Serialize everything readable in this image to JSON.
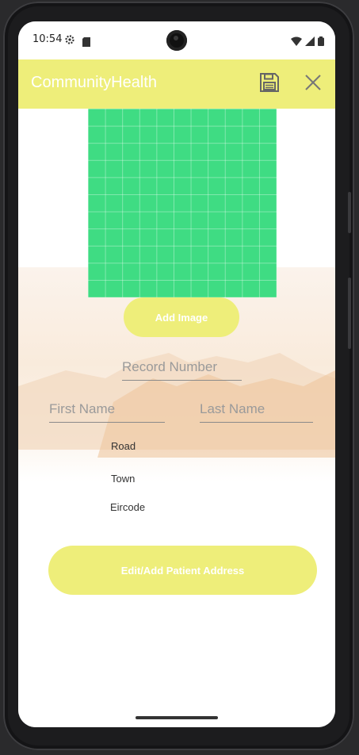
{
  "status_bar": {
    "time": "10:54",
    "icons": [
      "gear-icon",
      "sd-card-icon",
      "wifi-icon",
      "signal-icon",
      "battery-icon"
    ]
  },
  "appbar": {
    "title": "CommunityHealth",
    "color": "#eeee7a",
    "actions": [
      "save-icon",
      "close-icon"
    ]
  },
  "image_placeholder": {
    "color": "#3fdc83"
  },
  "buttons": {
    "add_image": "Add Image",
    "edit_address": "Edit/Add Patient Address"
  },
  "fields": {
    "record_number": {
      "placeholder": "Record Number",
      "value": ""
    },
    "first_name": {
      "placeholder": "First Name",
      "value": ""
    },
    "last_name": {
      "placeholder": "Last Name",
      "value": ""
    }
  },
  "address": {
    "road": "Road",
    "town": "Town",
    "eircode": "Eircode"
  }
}
